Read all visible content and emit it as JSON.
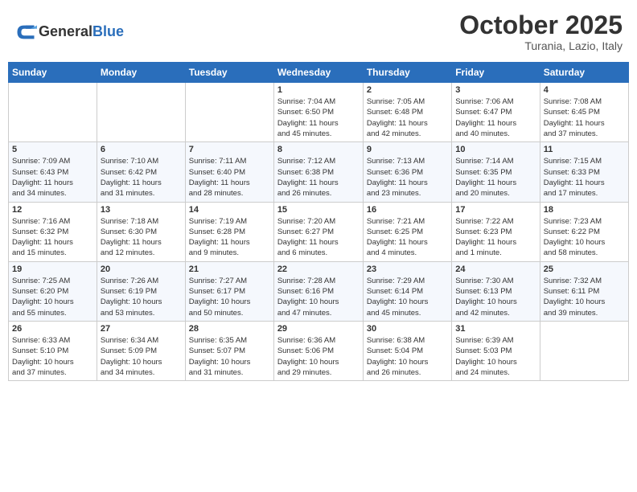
{
  "app": {
    "name": "GeneralBlue",
    "logo_label": "General Blue"
  },
  "calendar": {
    "month": "October 2025",
    "location": "Turania, Lazio, Italy",
    "header_color": "#2a6ebb",
    "weekdays": [
      "Sunday",
      "Monday",
      "Tuesday",
      "Wednesday",
      "Thursday",
      "Friday",
      "Saturday"
    ],
    "rows": [
      [
        {
          "day": "",
          "info": ""
        },
        {
          "day": "",
          "info": ""
        },
        {
          "day": "",
          "info": ""
        },
        {
          "day": "1",
          "info": "Sunrise: 7:04 AM\nSunset: 6:50 PM\nDaylight: 11 hours\nand 45 minutes."
        },
        {
          "day": "2",
          "info": "Sunrise: 7:05 AM\nSunset: 6:48 PM\nDaylight: 11 hours\nand 42 minutes."
        },
        {
          "day": "3",
          "info": "Sunrise: 7:06 AM\nSunset: 6:47 PM\nDaylight: 11 hours\nand 40 minutes."
        },
        {
          "day": "4",
          "info": "Sunrise: 7:08 AM\nSunset: 6:45 PM\nDaylight: 11 hours\nand 37 minutes."
        }
      ],
      [
        {
          "day": "5",
          "info": "Sunrise: 7:09 AM\nSunset: 6:43 PM\nDaylight: 11 hours\nand 34 minutes."
        },
        {
          "day": "6",
          "info": "Sunrise: 7:10 AM\nSunset: 6:42 PM\nDaylight: 11 hours\nand 31 minutes."
        },
        {
          "day": "7",
          "info": "Sunrise: 7:11 AM\nSunset: 6:40 PM\nDaylight: 11 hours\nand 28 minutes."
        },
        {
          "day": "8",
          "info": "Sunrise: 7:12 AM\nSunset: 6:38 PM\nDaylight: 11 hours\nand 26 minutes."
        },
        {
          "day": "9",
          "info": "Sunrise: 7:13 AM\nSunset: 6:36 PM\nDaylight: 11 hours\nand 23 minutes."
        },
        {
          "day": "10",
          "info": "Sunrise: 7:14 AM\nSunset: 6:35 PM\nDaylight: 11 hours\nand 20 minutes."
        },
        {
          "day": "11",
          "info": "Sunrise: 7:15 AM\nSunset: 6:33 PM\nDaylight: 11 hours\nand 17 minutes."
        }
      ],
      [
        {
          "day": "12",
          "info": "Sunrise: 7:16 AM\nSunset: 6:32 PM\nDaylight: 11 hours\nand 15 minutes."
        },
        {
          "day": "13",
          "info": "Sunrise: 7:18 AM\nSunset: 6:30 PM\nDaylight: 11 hours\nand 12 minutes."
        },
        {
          "day": "14",
          "info": "Sunrise: 7:19 AM\nSunset: 6:28 PM\nDaylight: 11 hours\nand 9 minutes."
        },
        {
          "day": "15",
          "info": "Sunrise: 7:20 AM\nSunset: 6:27 PM\nDaylight: 11 hours\nand 6 minutes."
        },
        {
          "day": "16",
          "info": "Sunrise: 7:21 AM\nSunset: 6:25 PM\nDaylight: 11 hours\nand 4 minutes."
        },
        {
          "day": "17",
          "info": "Sunrise: 7:22 AM\nSunset: 6:23 PM\nDaylight: 11 hours\nand 1 minute."
        },
        {
          "day": "18",
          "info": "Sunrise: 7:23 AM\nSunset: 6:22 PM\nDaylight: 10 hours\nand 58 minutes."
        }
      ],
      [
        {
          "day": "19",
          "info": "Sunrise: 7:25 AM\nSunset: 6:20 PM\nDaylight: 10 hours\nand 55 minutes."
        },
        {
          "day": "20",
          "info": "Sunrise: 7:26 AM\nSunset: 6:19 PM\nDaylight: 10 hours\nand 53 minutes."
        },
        {
          "day": "21",
          "info": "Sunrise: 7:27 AM\nSunset: 6:17 PM\nDaylight: 10 hours\nand 50 minutes."
        },
        {
          "day": "22",
          "info": "Sunrise: 7:28 AM\nSunset: 6:16 PM\nDaylight: 10 hours\nand 47 minutes."
        },
        {
          "day": "23",
          "info": "Sunrise: 7:29 AM\nSunset: 6:14 PM\nDaylight: 10 hours\nand 45 minutes."
        },
        {
          "day": "24",
          "info": "Sunrise: 7:30 AM\nSunset: 6:13 PM\nDaylight: 10 hours\nand 42 minutes."
        },
        {
          "day": "25",
          "info": "Sunrise: 7:32 AM\nSunset: 6:11 PM\nDaylight: 10 hours\nand 39 minutes."
        }
      ],
      [
        {
          "day": "26",
          "info": "Sunrise: 6:33 AM\nSunset: 5:10 PM\nDaylight: 10 hours\nand 37 minutes."
        },
        {
          "day": "27",
          "info": "Sunrise: 6:34 AM\nSunset: 5:09 PM\nDaylight: 10 hours\nand 34 minutes."
        },
        {
          "day": "28",
          "info": "Sunrise: 6:35 AM\nSunset: 5:07 PM\nDaylight: 10 hours\nand 31 minutes."
        },
        {
          "day": "29",
          "info": "Sunrise: 6:36 AM\nSunset: 5:06 PM\nDaylight: 10 hours\nand 29 minutes."
        },
        {
          "day": "30",
          "info": "Sunrise: 6:38 AM\nSunset: 5:04 PM\nDaylight: 10 hours\nand 26 minutes."
        },
        {
          "day": "31",
          "info": "Sunrise: 6:39 AM\nSunset: 5:03 PM\nDaylight: 10 hours\nand 24 minutes."
        },
        {
          "day": "",
          "info": ""
        }
      ]
    ]
  }
}
